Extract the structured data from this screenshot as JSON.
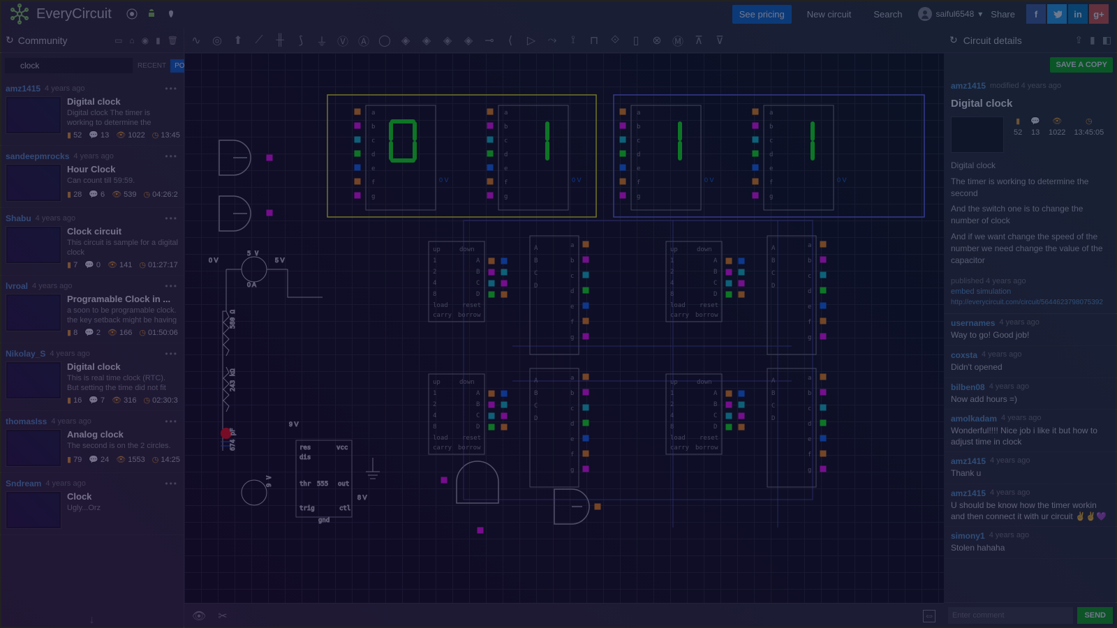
{
  "header": {
    "brand": "EveryCircuit",
    "see_pricing": "See pricing",
    "new_circuit": "New circuit",
    "search": "Search",
    "username": "saiful6548",
    "share": "Share"
  },
  "left": {
    "title": "Community",
    "search_value": "clock",
    "recent": "RECENT",
    "popular": "POPULAR",
    "cards": [
      {
        "author": "amz1415",
        "time": "4 years ago",
        "title": "Digital clock",
        "desc": "Digital clock\nThe timer is working to determine the second...",
        "b": "52",
        "c": "13",
        "v": "1022",
        "t": "13:45"
      },
      {
        "author": "sandeepmrocks",
        "time": "4 years ago",
        "title": "Hour Clock",
        "desc": "Can count till 59:59.",
        "b": "28",
        "c": "6",
        "v": "539",
        "t": "04:26:2"
      },
      {
        "author": "Shabu",
        "time": "4 years ago",
        "title": "Clock circuit",
        "desc": "This circuit is sample for a digital clock",
        "b": "7",
        "c": "0",
        "v": "141",
        "t": "01:27:17"
      },
      {
        "author": "lvroal",
        "time": "4 years ago",
        "title": "Programable Clock in ...",
        "desc": "a soon to be programable clock. the key setback might be having to take off the...",
        "b": "8",
        "c": "2",
        "v": "166",
        "t": "01:50:06"
      },
      {
        "author": "Nikolay_S",
        "time": "4 years ago",
        "title": "Digital clock",
        "desc": "This is real time clock (RTC). But setting the time did not fit into this...",
        "b": "16",
        "c": "7",
        "v": "316",
        "t": "02:30:3"
      },
      {
        "author": "thomasIss",
        "time": "4 years ago",
        "title": "Analog clock",
        "desc": "The second is on the 2 circles.",
        "b": "79",
        "c": "24",
        "v": "1553",
        "t": "14:25"
      },
      {
        "author": "Sndream",
        "time": "4 years ago",
        "title": "Clock",
        "desc": "Ugly...Orz",
        "b": "",
        "c": "",
        "v": "",
        "t": ""
      }
    ]
  },
  "right": {
    "title": "Circuit details",
    "save": "SAVE A COPY",
    "author": "amz1415",
    "modified": "modified 4 years ago",
    "circuit_title": "Digital clock",
    "stats": {
      "b": "52",
      "c": "13",
      "v": "1022",
      "t": "13:45:05"
    },
    "body": [
      "Digital clock",
      "The timer is working to determine the second",
      "And the switch one is to change the number of clock",
      "And if we want change the speed of the number we need change the value of the capacitor"
    ],
    "published": "published 4 years ago",
    "embed": "embed simulation",
    "url": "http://everycircuit.com/circuit/5644623798075392",
    "comments": [
      {
        "author": "usernames",
        "time": "4 years ago",
        "text": "Way to go! Good job!"
      },
      {
        "author": "coxsta",
        "time": "4 years ago",
        "text": "Didn't opened"
      },
      {
        "author": "bilben08",
        "time": "4 years ago",
        "text": "Now add hours =)"
      },
      {
        "author": "amolkadam",
        "time": "4 years ago",
        "text": "Wonderful!!!! Nice job i like it but how to adjust time in clock"
      },
      {
        "author": "amz1415",
        "time": "4 years ago",
        "text": "Thank u"
      },
      {
        "author": "amz1415",
        "time": "4 years ago",
        "text": "U should be know how the timer workin and then connect it with ur circuit ✌✌💜"
      },
      {
        "author": "simony1",
        "time": "4 years ago",
        "text": "Stolen hahaha"
      }
    ],
    "placeholder": "Enter comment",
    "send": "SEND"
  },
  "canvas": {
    "digits": [
      "0",
      "1",
      "1",
      "1"
    ],
    "timer_label": "555",
    "voltages": {
      "src": "5 V",
      "pwr": "9 V",
      "bat": "8 V",
      "zero": "0 V",
      "cur": "0 A"
    },
    "resistors": {
      "r1": "580 Ω",
      "r2": "243 kΩ",
      "cap": "674 pF"
    }
  }
}
